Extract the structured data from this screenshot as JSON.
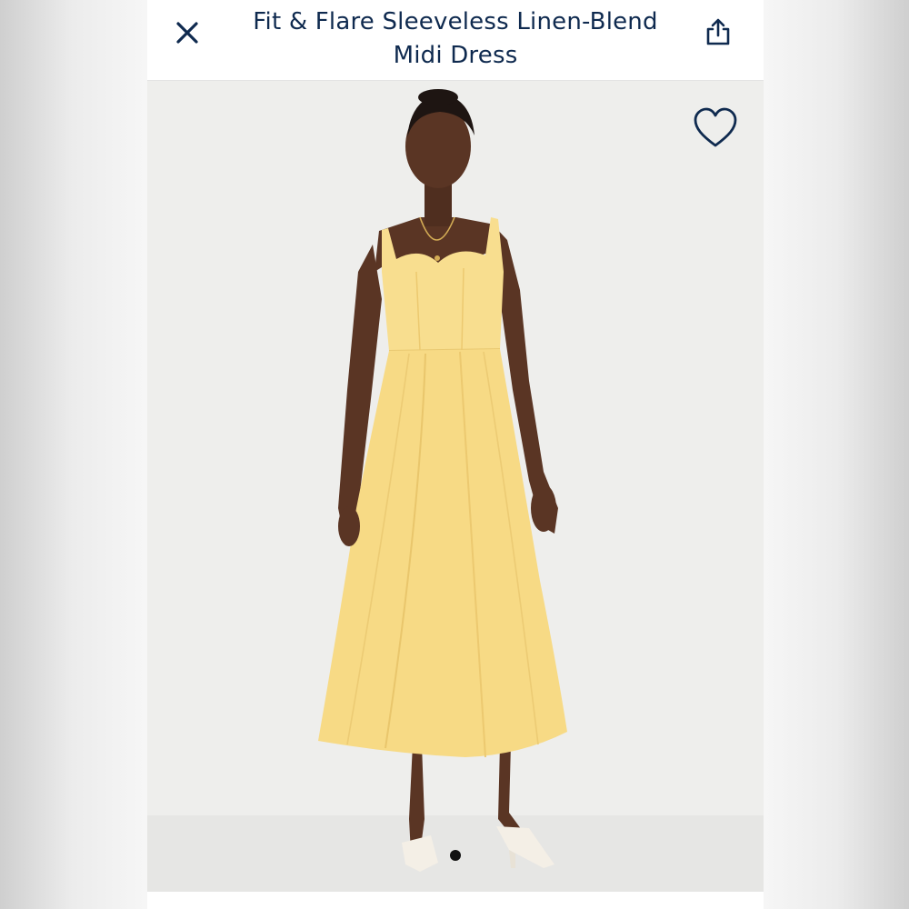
{
  "header": {
    "title_line1": "Fit & Flare Sleeveless Linen-Blend",
    "title_line2": "Midi Dress",
    "close_icon": "close-icon",
    "share_icon": "share-icon"
  },
  "gallery": {
    "favorite_icon": "heart-outline-icon",
    "image_description_hidden": "",
    "dot_count": 1,
    "active_dot": 1
  },
  "colors": {
    "title_text": "#0f2a4f",
    "icon_color": "#0f2a4f",
    "photo_background": "#eeeeec",
    "dress_yellow": "#f7dc8a",
    "indicator_active": "#111111"
  }
}
